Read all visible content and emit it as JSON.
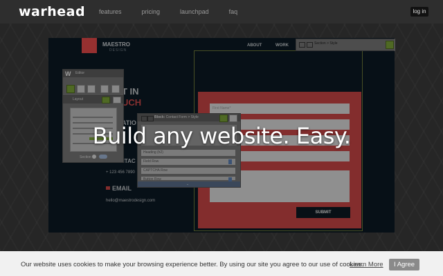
{
  "brand": {
    "logo": "warhead"
  },
  "nav": {
    "items": [
      "features",
      "pricing",
      "launchpad",
      "faq"
    ],
    "login": "log in"
  },
  "hero": {
    "headline": "Build any website. Easy."
  },
  "preview": {
    "logo_title": "MAESTRO",
    "logo_subtitle": "DESIGN",
    "nav": [
      "ABOUT",
      "WORK"
    ],
    "heading_line1": "T IN",
    "heading_line2": "UCH",
    "heading_partial": "ATIO",
    "contact_label": "CONTAC",
    "phone": "+ 123 456 7890",
    "email_label": "EMAIL",
    "email": "hello@maestrodesign.com",
    "form_field_label": "First Name*",
    "submit": "SUBMIT"
  },
  "panels": {
    "section": {
      "title": "Section > Style"
    },
    "editor": {
      "title": "Editor"
    },
    "layout": {
      "title": "Layout",
      "footer_label": "Section"
    },
    "block": {
      "title_prefix": "Block:",
      "title_path": "Contact Form > Style",
      "rows": [
        "Heading (h2)",
        "Field Row",
        "CAPTCHA Row",
        "Button Row"
      ]
    }
  },
  "cookie": {
    "text": "Our website uses cookies to make your browsing experience better. By using our site you agree to our use of cookies.",
    "link": "Learn More",
    "button": "I Agree"
  },
  "colors": {
    "accent_red": "#c94545",
    "accent_green": "#7aa138",
    "topbar": "#2e2e2e"
  }
}
